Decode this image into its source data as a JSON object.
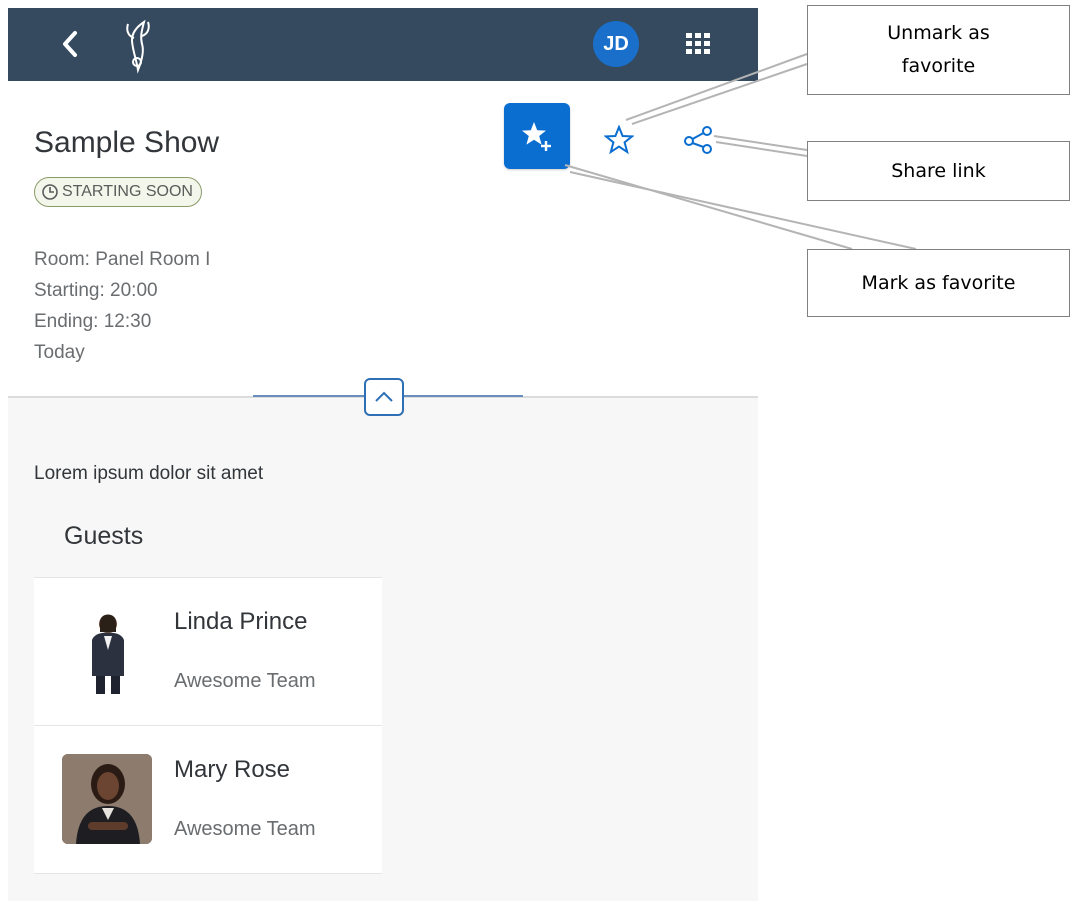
{
  "shellbar": {
    "avatar_initials": "JD",
    "brand_color": "#354a5f",
    "avatar_color": "#1a6fcb"
  },
  "header": {
    "title": "Sample Show",
    "status": "STARTING SOON",
    "room": "Room: Panel Room I",
    "starting": "Starting: 20:00",
    "ending": "Ending: 12:30",
    "day": "Today",
    "accent_color": "#0a6ed1"
  },
  "content": {
    "description": "Lorem ipsum dolor sit amet",
    "guests_title": "Guests",
    "guests": [
      {
        "name": "Linda Prince",
        "team": "Awesome Team"
      },
      {
        "name": "Mary Rose",
        "team": "Awesome Team"
      }
    ]
  },
  "annotations": {
    "unmark_favorite": "Unmark as favorite",
    "share_link": "Share link",
    "mark_favorite": "Mark as favorite"
  },
  "icons": [
    "back-icon",
    "app-logo-icon",
    "grid-menu-icon",
    "clock-icon",
    "star-add-icon",
    "star-outline-icon",
    "share-icon",
    "chevron-up-icon"
  ]
}
